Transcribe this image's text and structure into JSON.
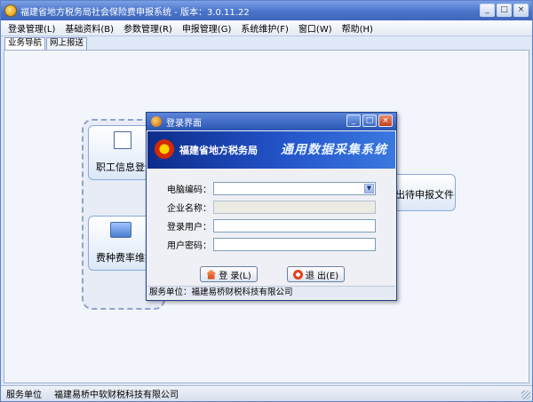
{
  "window": {
    "title": "福建省地方税务局社会保险费申报系统 - 版本：3.0.11.22",
    "btn_min": "_",
    "btn_max": "□",
    "btn_close": "×"
  },
  "menu": [
    {
      "label": "登录管理(L)"
    },
    {
      "label": "基础资料(B)"
    },
    {
      "label": "参数管理(R)"
    },
    {
      "label": "申报管理(G)"
    },
    {
      "label": "系统维护(F)"
    },
    {
      "label": "窗口(W)"
    },
    {
      "label": "帮助(H)"
    }
  ],
  "tabs": [
    {
      "label": "业务导航",
      "active": true
    },
    {
      "label": "网上报送",
      "active": false
    }
  ],
  "flow": {
    "card1": "职工信息登记",
    "card2": "费种费率维护",
    "card3": "出待申报文件",
    "card1_icon": "edit-note-icon",
    "card2_icon": "monitor-icon"
  },
  "dialog": {
    "title": "登录界面",
    "banner_org": "福建省地方税务局",
    "banner_system": "通用数据采集系统",
    "fields": {
      "computer_code": {
        "label": "电脑编码："
      },
      "company_name": {
        "label": "企业名称："
      },
      "login_user": {
        "label": "登录用户："
      },
      "password": {
        "label": "用户密码："
      }
    },
    "login_button": "登 录(L)",
    "exit_button": "退 出(E)",
    "footer": "服务单位：福建易桥财税科技有限公司"
  },
  "status": {
    "label": "服务单位",
    "value": "福建易桥中软财税科技有限公司"
  }
}
